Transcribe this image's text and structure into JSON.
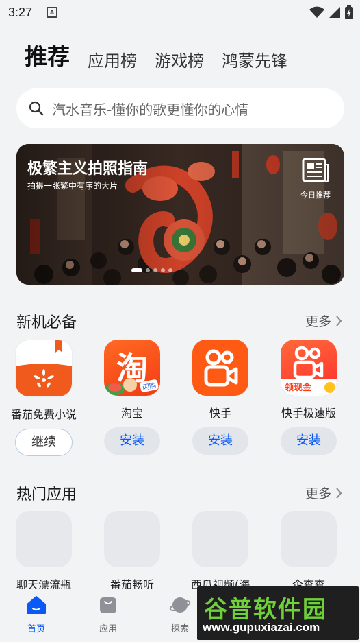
{
  "status_bar": {
    "time": "3:27",
    "indicator": "A"
  },
  "tabs": [
    {
      "label": "推荐",
      "active": true
    },
    {
      "label": "应用榜",
      "active": false
    },
    {
      "label": "游戏榜",
      "active": false
    },
    {
      "label": "鸿蒙先锋",
      "active": false
    }
  ],
  "search": {
    "placeholder": "汽水音乐-懂你的歌更懂你的心情"
  },
  "banner": {
    "title": "极繁主义拍照指南",
    "subtitle": "拍摄一张繁中有序的大片",
    "daily_label": "今日推荐",
    "page_count": 5,
    "active_page": 1
  },
  "new_phone_section": {
    "title": "新机必备",
    "more": "更多",
    "apps": [
      {
        "name": "番茄免费小说",
        "button": "继续",
        "icon": "tomato-novel-icon"
      },
      {
        "name": "淘宝",
        "button": "安装",
        "icon": "taobao-icon",
        "icon_text": "淘",
        "tag": "闪购"
      },
      {
        "name": "快手",
        "button": "安装",
        "icon": "kuaishou-icon"
      },
      {
        "name": "快手极速版",
        "button": "安装",
        "icon": "kuaishou-lite-icon",
        "tag": "领现金"
      }
    ]
  },
  "hot_section": {
    "title": "热门应用",
    "more": "更多",
    "apps": [
      {
        "name": "聊天漂流瓶"
      },
      {
        "name": "番茄畅听"
      },
      {
        "name": "西瓜视频(海"
      },
      {
        "name": "企查查"
      }
    ]
  },
  "bottom_nav": [
    {
      "label": "首页",
      "active": true
    },
    {
      "label": "应用",
      "active": false
    },
    {
      "label": "探索",
      "active": false
    }
  ],
  "watermark": {
    "title": "谷普软件园",
    "url": "www.gupuxiazai.com"
  },
  "colors": {
    "accent": "#0a59f7",
    "background": "#f1f3f5"
  }
}
